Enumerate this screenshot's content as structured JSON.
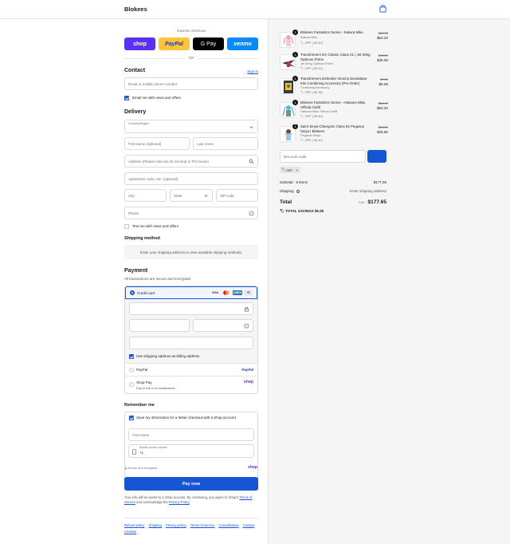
{
  "brand": "Blokees",
  "express": {
    "label": "Express checkout",
    "buttons": [
      "shop",
      "PayPal",
      "G Pay",
      "venmo"
    ],
    "or": "OR"
  },
  "contact": {
    "heading": "Contact",
    "sign_in": "Sign in",
    "email_placeholder": "Email or mobile phone number",
    "news_label": "Email me with news and offers"
  },
  "delivery": {
    "heading": "Delivery",
    "country_label": "Country/Region",
    "first_name": "First name (optional)",
    "last_name": "Last name",
    "address": "Address (Please note we do not ship to PO boxes)",
    "apartment": "Apartment, suite, etc. (optional)",
    "city": "City",
    "state": "State",
    "zip": "ZIP code",
    "phone": "Phone",
    "text_label": "Text me with news and offers"
  },
  "shipping_method": {
    "heading": "Shipping method",
    "message": "Enter your shipping address to view available shipping methods."
  },
  "payment": {
    "heading": "Payment",
    "subtitle": "All transactions are secure and encrypted.",
    "credit_card": "Credit card",
    "card_logos": [
      "VISA",
      "MC",
      "AMEX",
      "+5"
    ],
    "billing_label": "Use shipping address as billing address",
    "paypal": "PayPal",
    "paypal_logo": "PayPal",
    "shop_pay": "Shop Pay",
    "shop_pay_sub": "Pay in full or in installments",
    "shop_pay_logo": "shop"
  },
  "remember": {
    "heading": "Remember me",
    "save_label": "Save my information for a faster checkout with a Shop account",
    "first_name": "First name",
    "mobile_label": "Mobile phone number",
    "mobile_value": "+1",
    "secure": "Secure and encrypted",
    "shop_logo": "shop"
  },
  "pay_now": "Pay now",
  "legal": {
    "text": "Your info will be saved to a Shop account. By continuing, you agree to Shop’s",
    "terms": "Terms of Service",
    "and": "and acknowledge the",
    "privacy": "Privacy Policy"
  },
  "footer": [
    "Refund policy",
    "Shipping",
    "Privacy policy",
    "Terms of service",
    "Cancellations",
    "Contact",
    "Cookies"
  ],
  "items": [
    {
      "qty": "1",
      "title": "Blokees Fantastics Series - Sakura Miku",
      "sub": "Sakura Miku",
      "tag": "DPF (-$2.80)",
      "old": "$56.00",
      "price": "$53.20"
    },
    {
      "qty": "1",
      "title": "Transformers DX Classic Class 21 | Jet Wing Optimus Prime",
      "sub": "Jet Wing Optimus Prime",
      "tag": "DPF (-$2.00)",
      "old": "$40.00",
      "price": "$38.00"
    },
    {
      "qty": "1",
      "title": "Transformers Defender Version Devastator Kits Combining Accessory (Pre-Order)",
      "sub": "Combining Accessory",
      "tag": "DPF (-$0.35)",
      "old": "$7.00",
      "price": "$6.65"
    },
    {
      "qty": "1",
      "title": "Blokees Fantastics Series - Hatsune Miku Official Outfit",
      "sub": "Hatsune Miku Official Outfit",
      "tag": "DPF (-$2.80)",
      "old": "$56.00",
      "price": "$53.20"
    },
    {
      "qty": "1",
      "title": "Saint Seiya Champion Class 04 Pegasus Seiya | Blokees",
      "sub": "Pegasus Seiya",
      "tag": "DPF (-$1.40)",
      "old": "$28.00",
      "price": "$26.60"
    }
  ],
  "discount_placeholder": "Discount code",
  "applied_code": "DPF",
  "summary": {
    "subtotal_label": "Subtotal · 5 items",
    "subtotal": "$177.65",
    "shipping_label": "Shipping",
    "shipping_value": "Enter shipping address",
    "total_label": "Total",
    "currency": "CAD",
    "total": "$177.65",
    "savings_label": "TOTAL SAVINGS",
    "savings": "$9.35"
  },
  "colors": {
    "accent": "#1456d6",
    "shop": "#5a31f4",
    "paypal": "#ffc439",
    "venmo": "#008cff"
  }
}
